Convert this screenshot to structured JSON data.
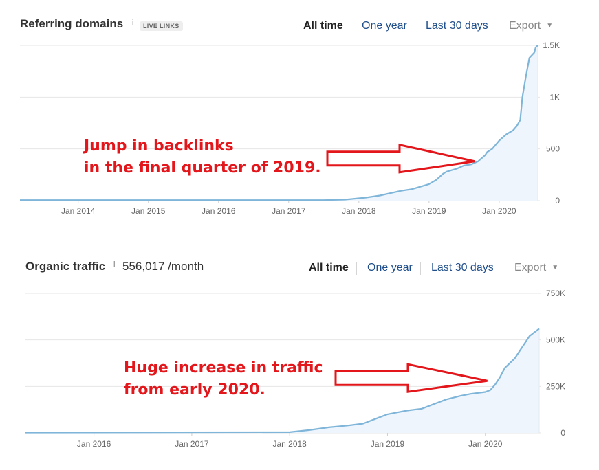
{
  "referring": {
    "title": "Referring domains",
    "info": "i",
    "badge": "LIVE LINKS",
    "tabs": [
      "All time",
      "One year",
      "Last 30 days"
    ],
    "export_label": "Export",
    "annotation": [
      "Jump in backlinks",
      "in the final quarter of 2019."
    ]
  },
  "organic": {
    "title": "Organic traffic",
    "info": "i",
    "metric": "556,017 /month",
    "tabs": [
      "All time",
      "One year",
      "Last 30 days"
    ],
    "export_label": "Export",
    "annotation": [
      "Huge increase in traffic",
      "from early 2020."
    ]
  },
  "colors": {
    "line": "#7fb5d9",
    "area": "#eef5fc",
    "annotation": "#e3161b",
    "grid": "#e6e6e6"
  },
  "chart_data": [
    {
      "type": "area",
      "ylim": [
        0,
        1500
      ],
      "yticks": [
        0,
        500,
        1000,
        1500
      ],
      "ytick_labels": [
        "0",
        "500",
        "1K",
        "1.5K"
      ],
      "xlim": [
        2013.17,
        2020.55
      ],
      "xticks": [
        2014,
        2015,
        2016,
        2017,
        2018,
        2019,
        2020
      ],
      "xtick_labels": [
        "Jan 2014",
        "Jan 2015",
        "Jan 2016",
        "Jan 2017",
        "Jan 2018",
        "Jan 2019",
        "Jan 2020"
      ],
      "grid": true,
      "series": [
        {
          "x": [
            2013.17,
            2017.5,
            2017.8,
            2018.1,
            2018.3,
            2018.5,
            2018.6,
            2018.75,
            2018.9,
            2019.0,
            2019.1,
            2019.2,
            2019.25,
            2019.4,
            2019.5,
            2019.6,
            2019.7,
            2019.8,
            2019.83,
            2019.9,
            2020.0,
            2020.1,
            2020.2,
            2020.25,
            2020.3,
            2020.33,
            2020.38,
            2020.43,
            2020.5,
            2020.52,
            2020.55
          ],
          "y": [
            5,
            5,
            10,
            30,
            50,
            80,
            95,
            110,
            140,
            160,
            200,
            260,
            280,
            310,
            340,
            350,
            380,
            440,
            470,
            500,
            580,
            640,
            680,
            720,
            780,
            1000,
            1200,
            1380,
            1430,
            1480,
            1500
          ]
        }
      ],
      "annotation": {
        "x": 2019.65,
        "y": 380
      }
    },
    {
      "type": "area",
      "ylim": [
        0,
        750000
      ],
      "yticks": [
        0,
        250000,
        500000,
        750000
      ],
      "ytick_labels": [
        "0",
        "250K",
        "500K",
        "750K"
      ],
      "xlim": [
        2015.3,
        2020.55
      ],
      "xticks": [
        2016,
        2017,
        2018,
        2019,
        2020
      ],
      "xtick_labels": [
        "Jan 2016",
        "Jan 2017",
        "Jan 2018",
        "Jan 2019",
        "Jan 2020"
      ],
      "grid": true,
      "series": [
        {
          "x": [
            2015.3,
            2018.0,
            2018.2,
            2018.4,
            2018.6,
            2018.75,
            2018.9,
            2019.0,
            2019.1,
            2019.2,
            2019.35,
            2019.5,
            2019.6,
            2019.75,
            2019.85,
            2020.0,
            2020.05,
            2020.1,
            2020.15,
            2020.2,
            2020.3,
            2020.4,
            2020.45,
            2020.5,
            2020.55
          ],
          "y": [
            2000,
            4000,
            15000,
            30000,
            40000,
            50000,
            80000,
            100000,
            110000,
            120000,
            130000,
            160000,
            180000,
            200000,
            210000,
            220000,
            230000,
            260000,
            300000,
            350000,
            400000,
            480000,
            520000,
            540000,
            560000
          ]
        }
      ],
      "annotation": {
        "x": 2020.02,
        "y": 280000
      }
    }
  ]
}
